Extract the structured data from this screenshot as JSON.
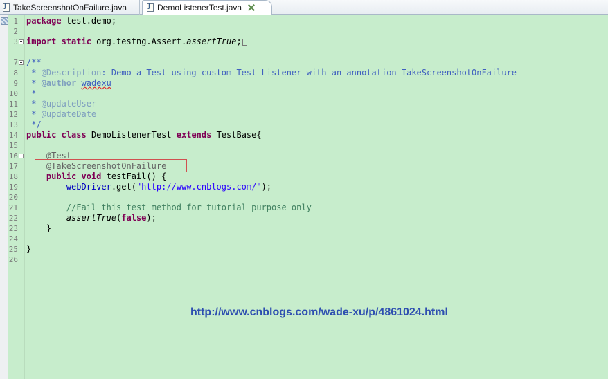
{
  "tabs": [
    {
      "label": "TakeScreenshotOnFailure.java",
      "active": false
    },
    {
      "label": "DemoListenerTest.java",
      "active": true
    }
  ],
  "editor": {
    "background": "#c7edcc",
    "line_numbers": [
      "1",
      "2",
      "3",
      "",
      "7",
      "8",
      "9",
      "10",
      "11",
      "12",
      "13",
      "14",
      "15",
      "16",
      "17",
      "18",
      "19",
      "20",
      "21",
      "22",
      "23",
      "24",
      "25",
      "26"
    ],
    "code": {
      "l1_kw": "package",
      "l1_rest": " test.demo;",
      "l3_kw1": "import",
      "l3_kw2": "static",
      "l3_pre": " org.testng.Assert.",
      "l3_method": "assertTrue",
      "l3_post": ";",
      "l7": "/**",
      "l8_pre": " * ",
      "l8_tag": "@Description",
      "l8_rest": ": Demo a Test using custom Test Listener with an annotation TakeScreenshotOnFailure",
      "l9_pre": " * ",
      "l9_tag": "@author",
      "l9_sp": " ",
      "l9_val": "wadexu",
      "l10": " *",
      "l11_pre": " * ",
      "l11_tag": "@updateUser",
      "l12_pre": " * ",
      "l12_tag": "@updateDate",
      "l13": " */",
      "l14_kw1": "public",
      "l14_kw2": "class",
      "l14_name": " DemoListenerTest ",
      "l14_kw3": "extends",
      "l14_rest": " TestBase{",
      "l16": "    @Test",
      "l17": "    @TakeScreenshotOnFailure",
      "l18_indent": "    ",
      "l18_kw1": "public",
      "l18_kw2": "void",
      "l18_rest": " testFail() {",
      "l19_indent": "        ",
      "l19_field": "webDriver",
      "l19_mid": ".get(",
      "l19_str": "\"http://www.cnblogs.com/\"",
      "l19_end": ");",
      "l21_indent": "        ",
      "l21_comment": "//Fail this test method for tutorial purpose only",
      "l22_indent": "        ",
      "l22_method": "assertTrue",
      "l22_open": "(",
      "l22_kw": "false",
      "l22_close": ");",
      "l23": "    }",
      "l25": "}"
    }
  },
  "watermark": "http://www.cnblogs.com/wade-xu/p/4861024.html",
  "colors": {
    "keyword": "#7f0055",
    "annotation": "#646464",
    "javadoc": "#3f5fbf",
    "javadoc_tag": "#7f9fbf",
    "string": "#2a00ff",
    "comment": "#3f7f5f",
    "field": "#0000c0",
    "watermark": "#2e4fb0",
    "highlight_box": "#d05050"
  },
  "icons": {
    "file": "java-file-icon",
    "close": "close-icon",
    "fold_collapse": "fold-collapse-icon",
    "fold_expand": "fold-expand-icon"
  }
}
